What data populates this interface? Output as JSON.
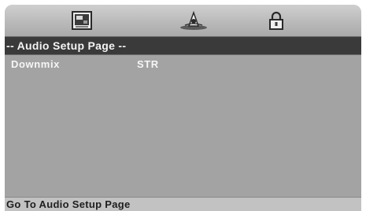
{
  "tabs": [
    {
      "icon": "general-setup-icon"
    },
    {
      "icon": "audio-setup-icon"
    },
    {
      "icon": "lock-icon"
    }
  ],
  "page": {
    "title": "-- Audio Setup Page --"
  },
  "settings": [
    {
      "label": "Downmix",
      "value": "STR"
    }
  ],
  "status": {
    "text": "Go To Audio Setup Page"
  },
  "colors": {
    "panel": "#a3a3a3",
    "header_bg": "#3a3a3a",
    "text": "#f6f6f6",
    "status_bg": "#c2c2c2"
  }
}
